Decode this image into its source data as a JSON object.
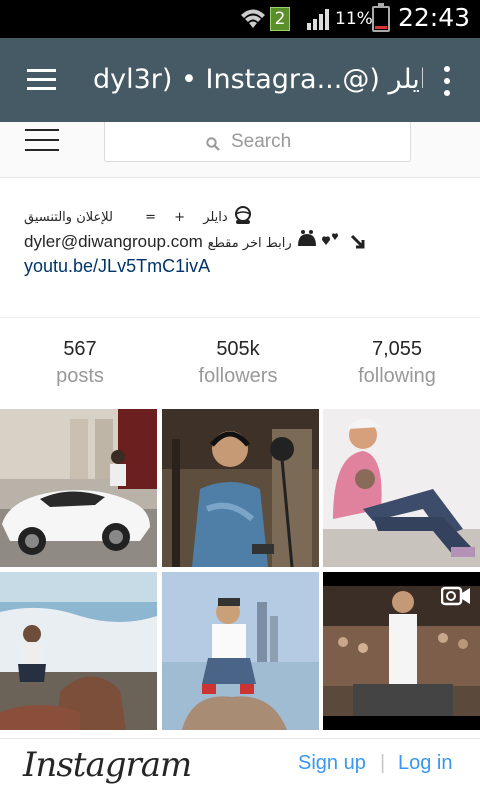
{
  "status_bar": {
    "sim_badge": "2",
    "battery_percent": "11%",
    "battery_level": 0.11,
    "time": "22:43",
    "icons": [
      "wifi-icon",
      "signal-icon",
      "battery-icon"
    ]
  },
  "app_bar": {
    "title": "dyl3r) • Instagra...@) دايلر",
    "icons": [
      "menu-icon",
      "overflow-menu-icon"
    ],
    "color": "#455a64"
  },
  "instagram": {
    "search": {
      "placeholder": "Search"
    },
    "bio": {
      "line1_name": "دايلر",
      "line1_plus": "+",
      "line1_equals": "=",
      "line1_text": "للإعلان والتنسيق",
      "line2_email": "dyler@diwangroup.com",
      "line2_text": "رابط اخر مقطع",
      "link": "youtu.be/JLv5TmC1ivA"
    },
    "stats": [
      {
        "value": "567",
        "label": "posts"
      },
      {
        "value": "505k",
        "label": "followers"
      },
      {
        "value": "7,055",
        "label": "following"
      }
    ],
    "grid_posts": [
      {
        "kind": "photo",
        "name": "car-photo"
      },
      {
        "kind": "photo",
        "name": "studio-photo"
      },
      {
        "kind": "photo",
        "name": "sitting-photo"
      },
      {
        "kind": "photo",
        "name": "beach-photo"
      },
      {
        "kind": "photo",
        "name": "city-photo"
      },
      {
        "kind": "video",
        "name": "stage-video"
      }
    ],
    "bottom": {
      "logo": "Instagram",
      "signup": "Sign up",
      "separator": "|",
      "login": "Log in"
    },
    "colors": {
      "link": "#003569",
      "action": "#3897f0",
      "muted": "#999999"
    }
  }
}
